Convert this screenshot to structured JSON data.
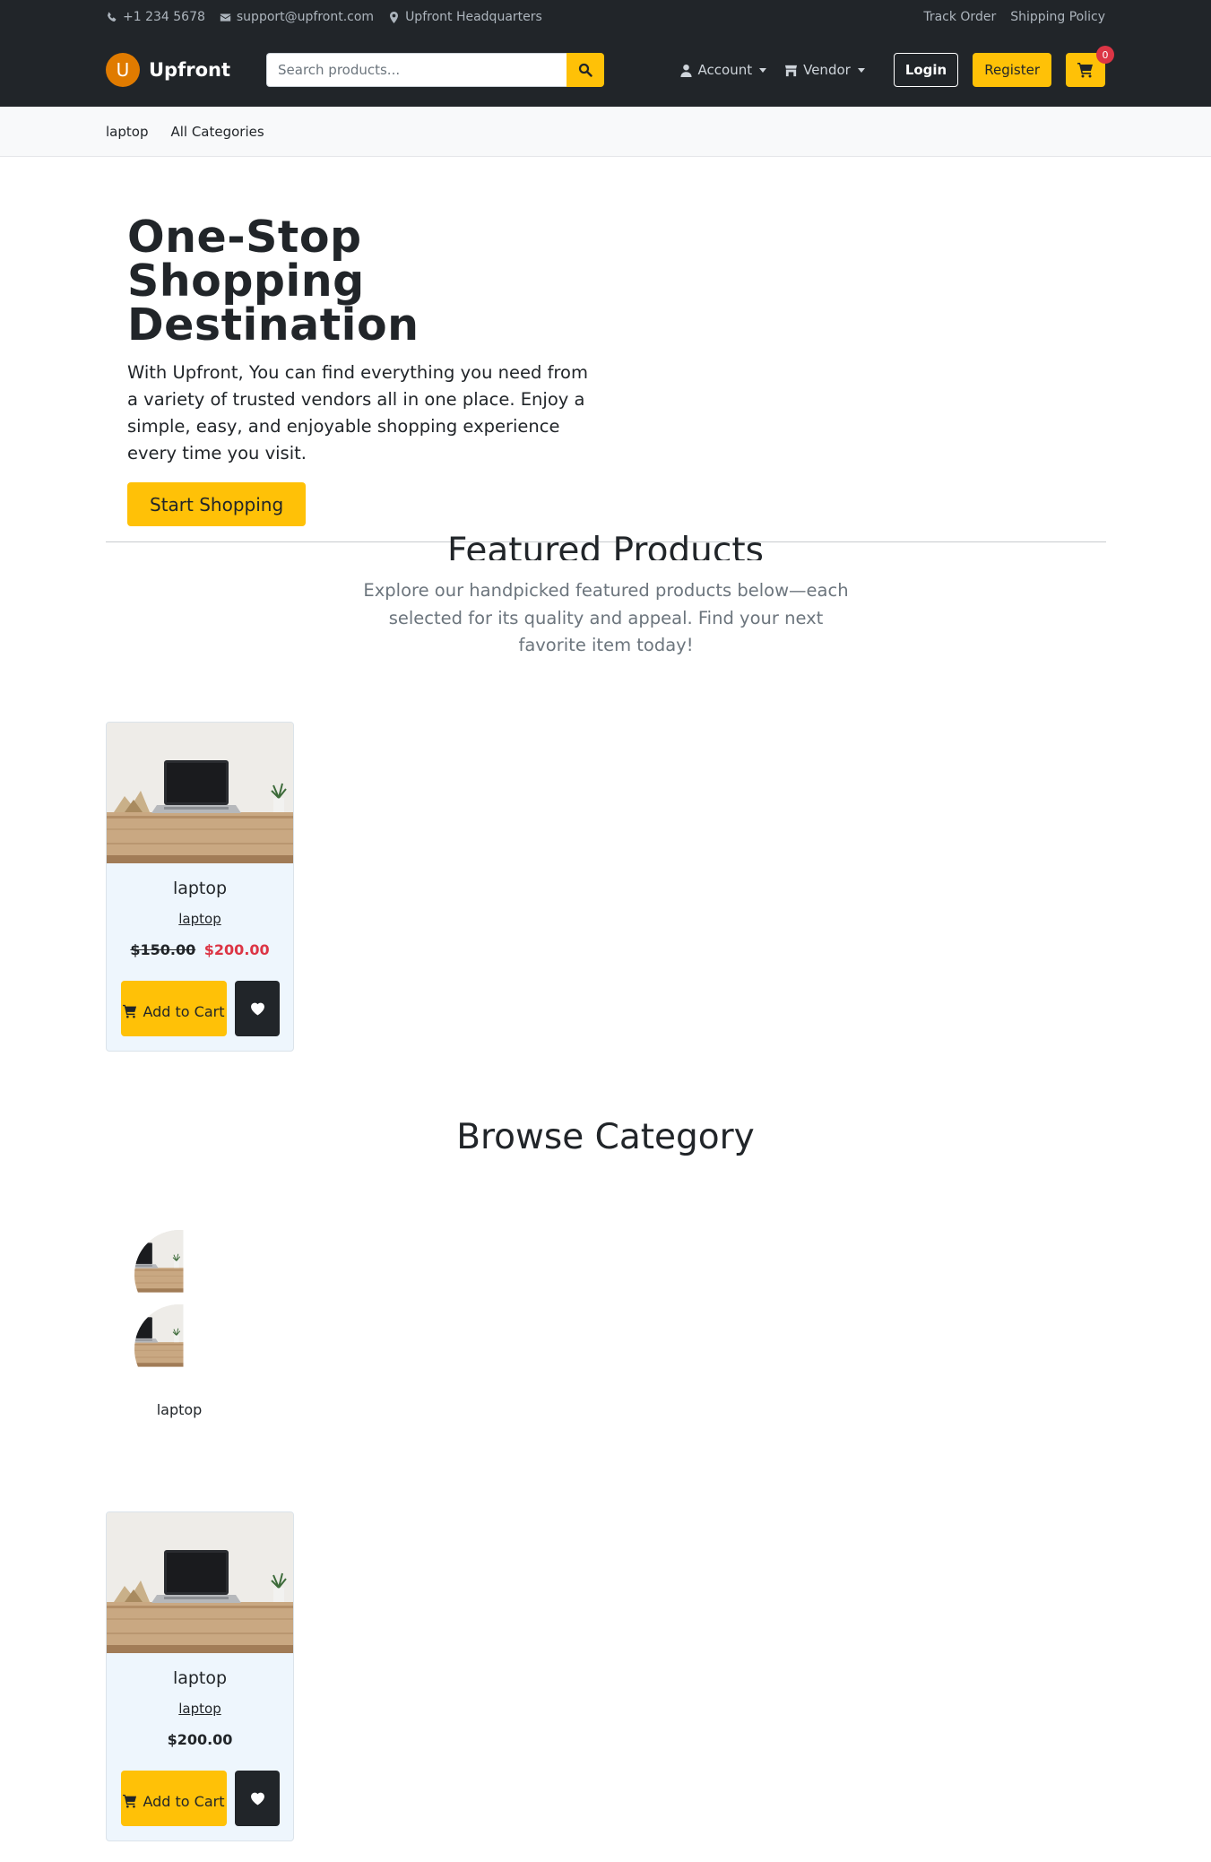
{
  "topbar": {
    "phone": "+1 234 5678",
    "email": "support@upfront.com",
    "location": "Upfront Headquarters",
    "links": [
      "Track Order",
      "Shipping Policy"
    ]
  },
  "nav": {
    "logo_letter": "U",
    "brand": "Upfront",
    "search_placeholder": "Search products...",
    "account": "Account",
    "vendor": "Vendor",
    "login": "Login",
    "register": "Register",
    "cart_count": "0"
  },
  "categories_bar": [
    "laptop",
    "All Categories"
  ],
  "hero": {
    "title": "One-Stop Shopping Destination",
    "text": "With Upfront, You can find everything you need from a variety of trusted vendors all in one place. Enjoy a simple, easy, and enjoyable shopping experience every time you visit.",
    "cta": "Start Shopping"
  },
  "featured": {
    "title": "Featured Products",
    "subtitle": "Explore our handpicked featured products below—each selected for its quality and appeal. Find your next favorite item today!",
    "products": [
      {
        "name": "laptop",
        "category": "laptop",
        "old_price": "$150.00",
        "price": "$200.00",
        "add_label": "Add to Cart"
      }
    ]
  },
  "browse": {
    "title": "Browse Category",
    "categories": [
      {
        "label": "laptop"
      }
    ]
  },
  "products": [
    {
      "name": "laptop",
      "category": "laptop",
      "price": "$200.00",
      "add_label": "Add to Cart"
    }
  ],
  "colors": {
    "header_bg": "#212529",
    "accent": "#ffc107",
    "sale_price": "#dc3545",
    "card_bg": "#eef6fd",
    "logo": "#e07b00"
  },
  "icons": [
    "phone-icon",
    "envelope-icon",
    "map-marker-icon",
    "search-icon",
    "user-icon",
    "store-icon",
    "cart-icon",
    "heart-icon"
  ]
}
